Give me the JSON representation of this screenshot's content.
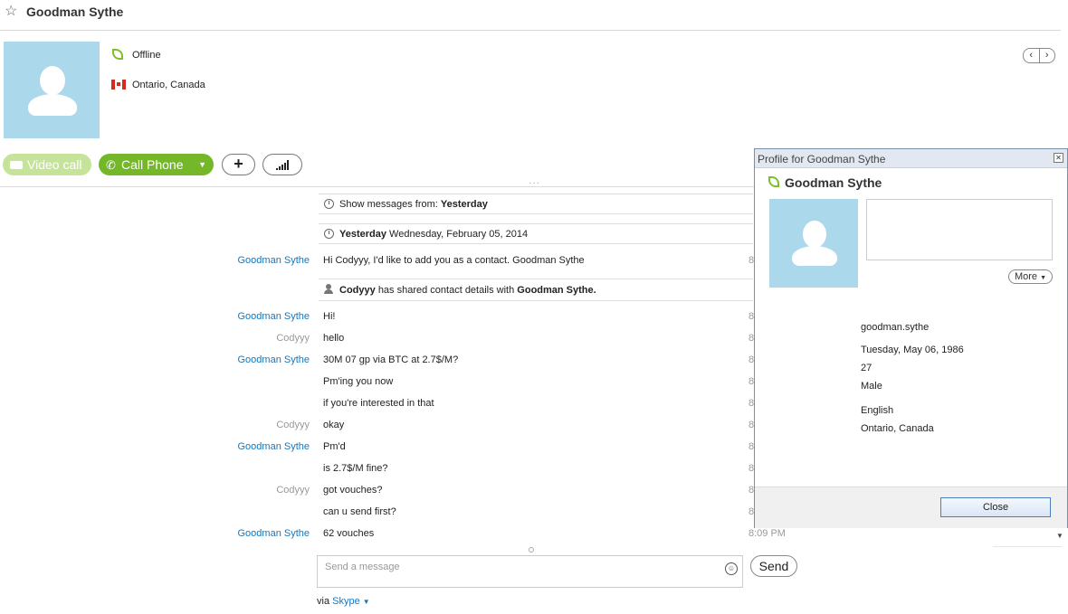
{
  "header": {
    "contact_name": "Goodman Sythe"
  },
  "profile": {
    "status": "Offline",
    "location": "Ontario, Canada"
  },
  "actions": {
    "video_call": "Video call",
    "call_phone": "Call Phone",
    "add": "+"
  },
  "conversation": {
    "show_from_label": "Show messages from:",
    "show_from_value": "Yesterday",
    "date_header_bold": "Yesterday",
    "date_header_rest": "Wednesday, February 05, 2014",
    "shared_actor": "Codyyy",
    "shared_text": "has shared contact details with",
    "shared_target": "Goodman Sythe.",
    "messages": [
      {
        "sender": "Goodman Sythe",
        "text": "Hi Codyyy, I'd like to add you as a contact. Goodman Sythe",
        "time": "8"
      },
      {
        "sender": "Goodman Sythe",
        "text": "Hi!",
        "time": "8"
      },
      {
        "sender": "Codyyy",
        "text": "hello",
        "time": "8"
      },
      {
        "sender": "Goodman Sythe",
        "text": "30M 07 gp via BTC at 2.7$/M?",
        "time": "8"
      },
      {
        "sender": "",
        "text": "Pm'ing you now",
        "time": "8"
      },
      {
        "sender": "",
        "text": "if you're interested in that",
        "time": "8"
      },
      {
        "sender": "Codyyy",
        "text": "okay",
        "time": "8"
      },
      {
        "sender": "Goodman Sythe",
        "text": "Pm'd",
        "time": "8"
      },
      {
        "sender": "",
        "text": "is 2.7$/M fine?",
        "time": "8"
      },
      {
        "sender": "Codyyy",
        "text": "got vouches?",
        "time": "8"
      },
      {
        "sender": "",
        "text": "can u send first?",
        "time": "8"
      },
      {
        "sender": "Goodman Sythe",
        "text": "62 vouches",
        "time": "8:09 PM"
      }
    ]
  },
  "composer": {
    "placeholder": "Send a message",
    "send_label": "Send",
    "via_prefix": "via",
    "via_service": "Skype"
  },
  "dialog": {
    "title": "Profile for Goodman Sythe",
    "name": "Goodman Sythe",
    "more_label": "More",
    "skype_name": "goodman.sythe",
    "birthday": "Tuesday, May 06, 1986",
    "age": "27",
    "gender": "Male",
    "language": "English",
    "location": "Ontario, Canada",
    "close_label": "Close"
  },
  "colors": {
    "accent_blue": "#1477bf",
    "call_green": "#74b82a",
    "video_green_disabled": "#c6e39a",
    "avatar_bg": "#abd8ea"
  }
}
